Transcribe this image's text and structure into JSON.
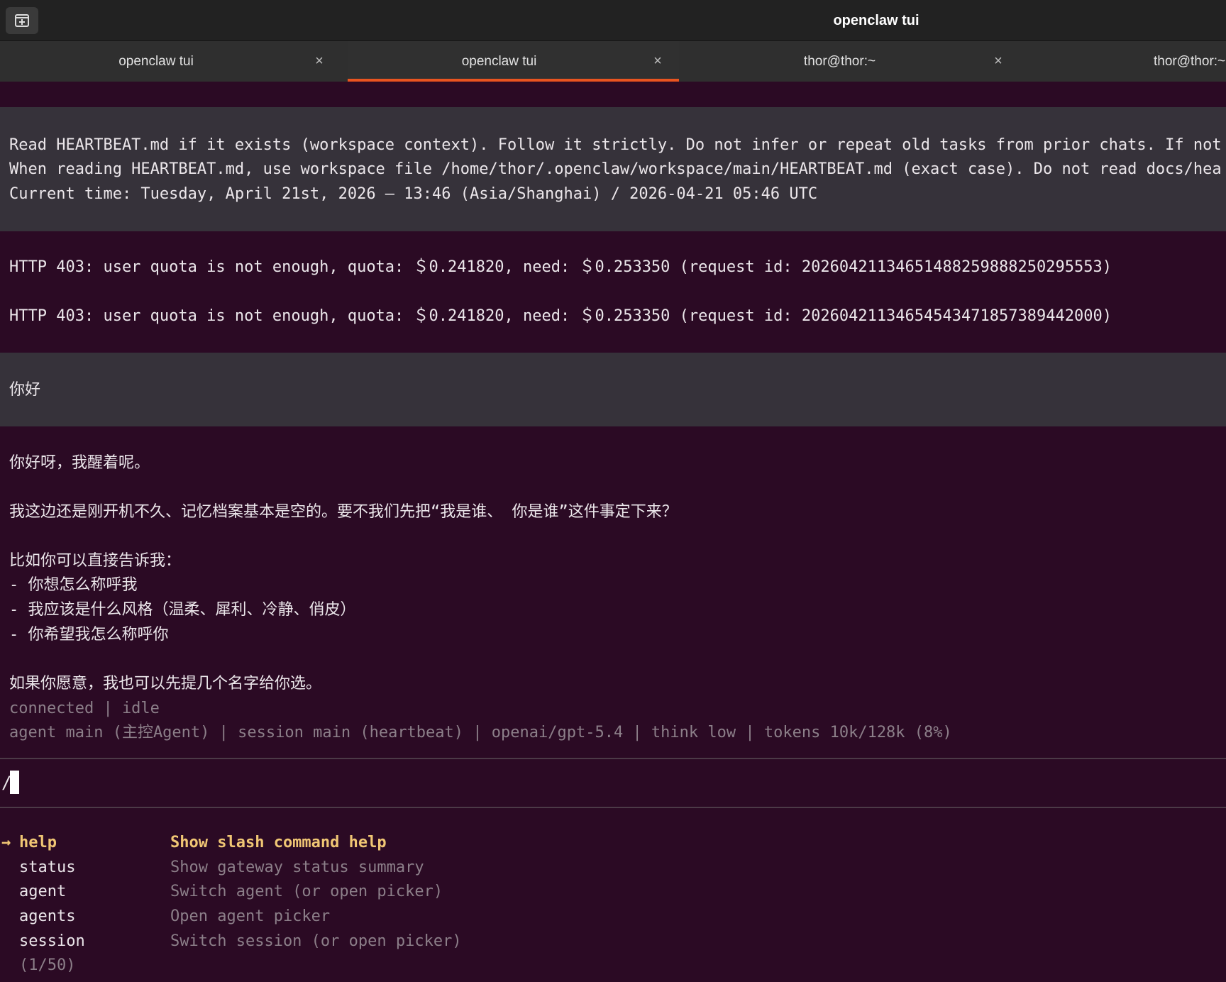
{
  "window": {
    "title": "openclaw tui"
  },
  "tabs": [
    {
      "label": "openclaw tui",
      "close": "×",
      "active": false
    },
    {
      "label": "openclaw tui",
      "close": "×",
      "active": true
    },
    {
      "label": "thor@thor:~",
      "close": "×",
      "active": false
    },
    {
      "label": "thor@thor:~",
      "close": "",
      "active": false
    }
  ],
  "terminal": {
    "system_lines": [
      "Read HEARTBEAT.md if it exists (workspace context). Follow it strictly. Do not infer or repeat old tasks from prior chats. If not",
      "When reading HEARTBEAT.md, use workspace file /home/thor/.openclaw/workspace/main/HEARTBEAT.md (exact case). Do not read docs/hea",
      "Current time: Tuesday, April 21st, 2026 — 13:46 (Asia/Shanghai) / 2026-04-21 05:46 UTC"
    ],
    "errors": [
      "HTTP 403: user quota is not enough, quota: ＄0.241820, need: ＄0.253350 (request id: 20260421134651488259888250295553)",
      "HTTP 403: user quota is not enough, quota: ＄0.241820, need: ＄0.253350 (request id: 20260421134654543471857389442000)"
    ],
    "user_message": "你好",
    "assistant_lines": [
      "你好呀，我醒着呢。",
      "",
      "我这边还是刚开机不久、记忆档案基本是空的。要不我们先把“我是谁、 你是谁”这件事定下来？",
      "",
      "比如你可以直接告诉我：",
      "- 你想怎么称呼我",
      "- 我应该是什么风格（温柔、犀利、冷静、俏皮）",
      "- 你希望我怎么称呼你",
      "",
      "如果你愿意，我也可以先提几个名字给你选。"
    ],
    "status_line": "connected | idle",
    "info_line": "agent main (主控Agent) | session main (heartbeat) | openai/gpt-5.4 | think low | tokens 10k/128k (8%)",
    "input": {
      "value": "/"
    },
    "commands": {
      "arrow": "→",
      "items": [
        {
          "name": "help",
          "description": "Show slash command help",
          "selected": true
        },
        {
          "name": "status",
          "description": "Show gateway status summary",
          "selected": false
        },
        {
          "name": "agent",
          "description": "Switch agent (or open picker)",
          "selected": false
        },
        {
          "name": "agents",
          "description": "Open agent picker",
          "selected": false
        },
        {
          "name": "session",
          "description": "Switch session (or open picker)",
          "selected": false
        }
      ],
      "pager": "(1/50)"
    }
  }
}
